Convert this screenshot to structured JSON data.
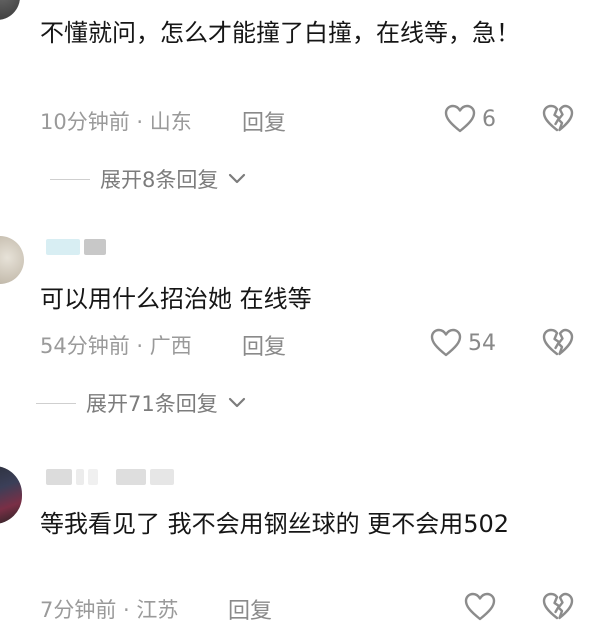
{
  "colors": {
    "text": "#161616",
    "meta": "#9a9a9a",
    "icon": "#8c8c8c"
  },
  "comments": [
    {
      "text": "不懂就问，怎么才能撞了白撞，在线等，急！",
      "time_location": "10分钟前 · 山东",
      "reply_label": "回复",
      "likes": "6",
      "expand_label": "展开8条回复"
    },
    {
      "text": "可以用什么招治她 在线等",
      "time_location": "54分钟前 · 广西",
      "reply_label": "回复",
      "likes": "54",
      "expand_label": "展开71条回复"
    },
    {
      "text": "等我看见了 我不会用钢丝球的 更不会用502",
      "time_location": "7分钟前 · 江苏",
      "reply_label": "回复",
      "likes": ""
    }
  ],
  "icons": {
    "like": "heart-outline-icon",
    "dislike": "broken-heart-icon",
    "expand": "chevron-down-icon"
  }
}
